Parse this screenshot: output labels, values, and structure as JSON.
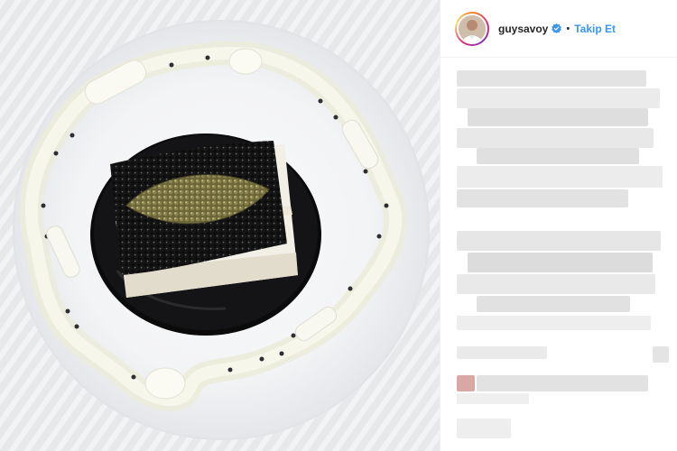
{
  "post": {
    "username": "guysavoy",
    "separator": "•",
    "follow_label": "Takip Et"
  },
  "colors": {
    "follow_blue": "#3897f0",
    "verified_blue": "#3897f0",
    "text": "#262626",
    "divider": "#efefef"
  },
  "icons": {
    "verified": "verified-badge-icon"
  }
}
